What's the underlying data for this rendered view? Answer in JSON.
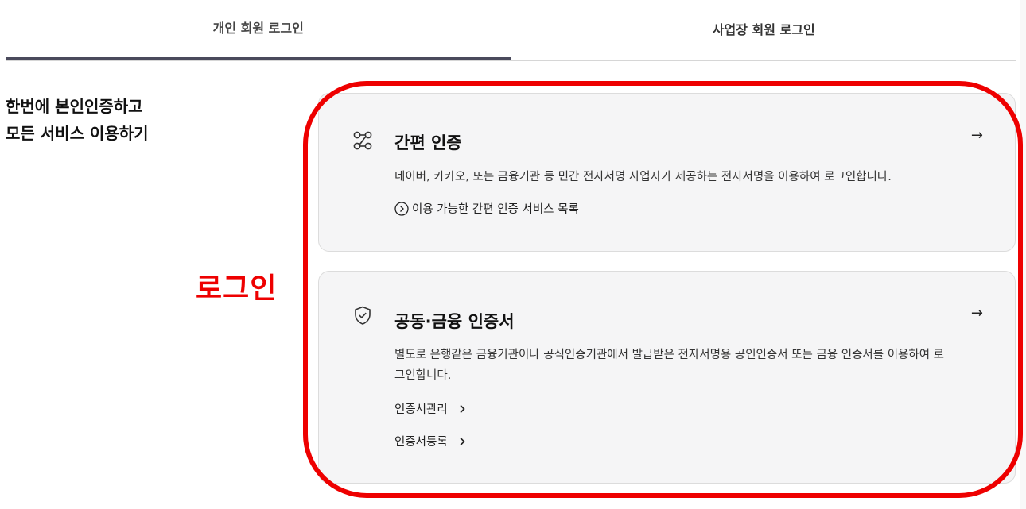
{
  "tabs": [
    {
      "label": "개인 회원 로그인",
      "active": true
    },
    {
      "label": "사업장 회원 로그인",
      "active": false
    }
  ],
  "headline": {
    "line1": "한번에 본인인증하고",
    "line2": "모든 서비스 이용하기"
  },
  "annotation": {
    "label": "로그인",
    "color": "#ee0000"
  },
  "cards": [
    {
      "icon": "easy-auth-icon",
      "title": "간편 인증",
      "arrow": "→",
      "description": "네이버, 카카오, 또는 금융기관 등 민간 전자서명 사업자가 제공하는 전자서명을 이용하여 로그인합니다.",
      "link": "이용 가능한 간편 인증 서비스 목록"
    },
    {
      "icon": "shield-check-icon",
      "title": "공동·금융 인증서",
      "arrow": "→",
      "description": "별도로 은행같은 금융기관이나 공식인증기관에서 발급받은 전자서명용 공인인증서 또는 금융 인증서를 이용하여 로그인합니다.",
      "links": [
        "인증서관리",
        "인증서등록"
      ]
    }
  ],
  "colors": {
    "active_tab_underline": "#4a4a5c",
    "card_background": "#f5f5f6"
  }
}
